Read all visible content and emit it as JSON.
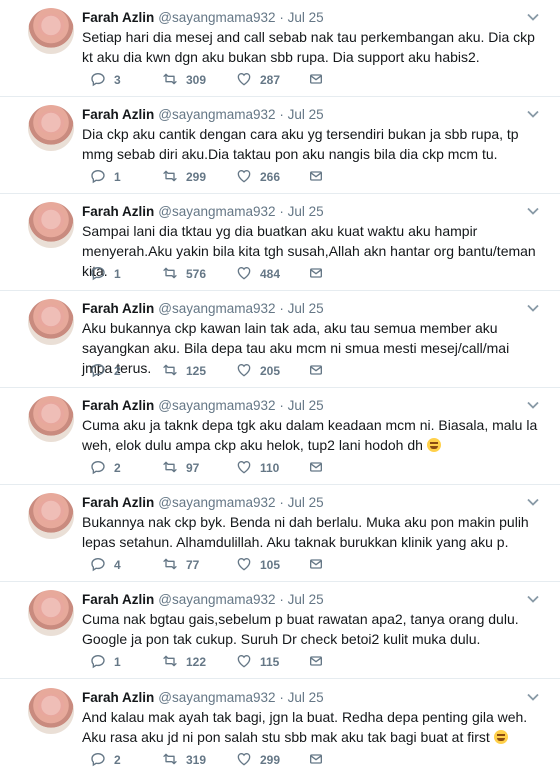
{
  "tweets": [
    {
      "name": "Farah Azlin",
      "handle": "@sayangmama932",
      "dot": "·",
      "date": "Jul 25",
      "text": "Setiap hari dia mesej and call sebab nak tau perkembangan aku. Dia ckp kt aku dia kwn dgn aku bukan sbb rupa. Dia support aku habis2.",
      "replies": "3",
      "retweets": "309",
      "likes": "287"
    },
    {
      "name": "Farah Azlin",
      "handle": "@sayangmama932",
      "dot": "·",
      "date": "Jul 25",
      "text": "Dia ckp aku cantik dengan cara aku yg tersendiri bukan ja sbb rupa, tp mmg sebab diri aku.Dia taktau pon aku nangis bila dia ckp mcm tu.",
      "replies": "1",
      "retweets": "299",
      "likes": "266"
    },
    {
      "name": "Farah Azlin",
      "handle": "@sayangmama932",
      "dot": "·",
      "date": "Jul 25",
      "text": "Sampai lani dia tktau yg dia buatkan aku kuat waktu aku hampir menyerah.Aku yakin bila kita tgh susah,Allah akn hantar org bantu/teman kita.",
      "replies": "1",
      "retweets": "576",
      "likes": "484"
    },
    {
      "name": "Farah Azlin",
      "handle": "@sayangmama932",
      "dot": "·",
      "date": "Jul 25",
      "text": "Aku bukannya ckp kawan lain tak ada, aku tau semua member aku sayangkan aku. Bila depa tau aku mcm ni smua mesti mesej/call/mai jmpa terus.",
      "replies": "2",
      "retweets": "125",
      "likes": "205"
    },
    {
      "name": "Farah Azlin",
      "handle": "@sayangmama932",
      "dot": "·",
      "date": "Jul 25",
      "text": "Cuma aku ja taknk depa tgk aku dalam keadaan mcm ni. Biasala, malu la weh, elok dulu ampa ckp aku helok, tup2 lani hodoh dh",
      "replies": "2",
      "retweets": "97",
      "likes": "110",
      "emoji": "laughing-tears"
    },
    {
      "name": "Farah Azlin",
      "handle": "@sayangmama932",
      "dot": "·",
      "date": "Jul 25",
      "text": "Bukannya nak ckp byk. Benda ni dah berlalu. Muka aku pon makin pulih lepas setahun. Alhamdulillah. Aku taknak burukkan klinik yang aku p.",
      "replies": "4",
      "retweets": "77",
      "likes": "105"
    },
    {
      "name": "Farah Azlin",
      "handle": "@sayangmama932",
      "dot": "·",
      "date": "Jul 25",
      "text": "Cuma nak bgtau gais,sebelum p buat rawatan apa2, tanya orang dulu. Google ja pon tak cukup. Suruh Dr check betoi2 kulit muka dulu.",
      "replies": "1",
      "retweets": "122",
      "likes": "115"
    },
    {
      "name": "Farah Azlin",
      "handle": "@sayangmama932",
      "dot": "·",
      "date": "Jul 25",
      "text": "And kalau mak ayah tak bagi, jgn la buat. Redha depa penting gila weh. Aku rasa aku jd ni pon salah stu sbb mak aku tak bagi buat at first",
      "replies": "2",
      "retweets": "319",
      "likes": "299",
      "emoji": "grinning"
    }
  ],
  "colors": {
    "muted": "#657786",
    "text": "#14171a",
    "divider": "#e6ecf0"
  },
  "icons": [
    "avatar",
    "chevron-down-icon",
    "reply-icon",
    "retweet-icon",
    "like-icon",
    "direct-message-icon"
  ]
}
